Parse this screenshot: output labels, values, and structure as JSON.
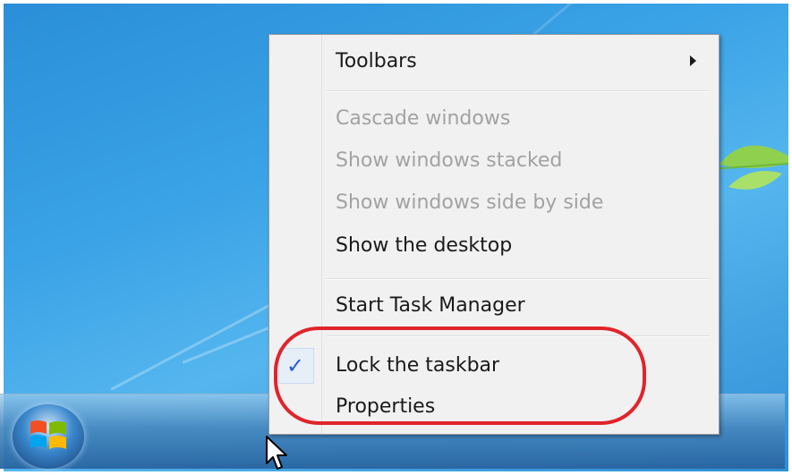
{
  "menu": {
    "items": [
      {
        "label": "Toolbars",
        "enabled": true,
        "submenu": true
      },
      {
        "label": "Cascade windows",
        "enabled": false
      },
      {
        "label": "Show windows stacked",
        "enabled": false
      },
      {
        "label": "Show windows side by side",
        "enabled": false
      },
      {
        "label": "Show the desktop",
        "enabled": true
      },
      {
        "label": "Start Task Manager",
        "enabled": true
      },
      {
        "label": "Lock the taskbar",
        "enabled": true,
        "checked": true
      },
      {
        "label": "Properties",
        "enabled": true
      }
    ],
    "check_glyph": "✓",
    "submenu_icon": "submenu-arrow-icon"
  },
  "taskbar": {
    "start_button_icon": "windows-logo-icon"
  },
  "highlight": {
    "color": "#e0242b",
    "target": "lock-taskbar-and-properties"
  },
  "colors": {
    "desktop_blue": "#3aa2e6",
    "menu_bg": "#f1f1f1",
    "disabled_text": "#a2a2a2",
    "check_color": "#2a5bd0"
  }
}
